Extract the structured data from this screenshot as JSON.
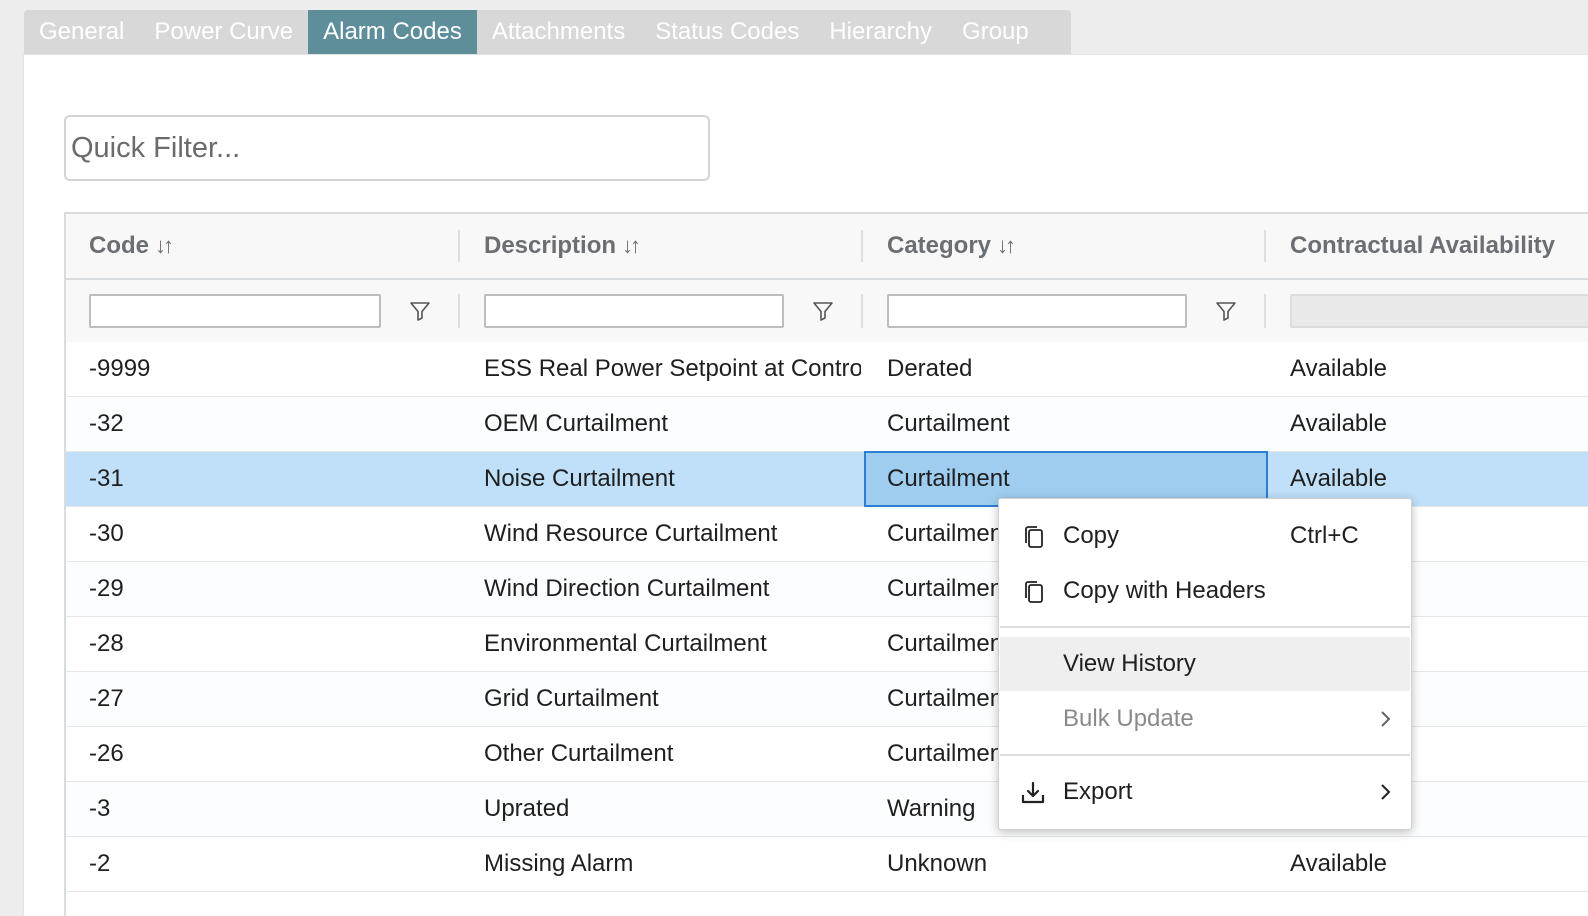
{
  "tabs": [
    {
      "label": "General",
      "active": false
    },
    {
      "label": "Power Curve",
      "active": false
    },
    {
      "label": "Alarm Codes",
      "active": true
    },
    {
      "label": "Attachments",
      "active": false
    },
    {
      "label": "Status Codes",
      "active": false
    },
    {
      "label": "Hierarchy",
      "active": false
    },
    {
      "label": "Group",
      "active": false
    }
  ],
  "quick_filter": {
    "placeholder": "Quick Filter...",
    "value": ""
  },
  "grid": {
    "columns": [
      {
        "label": "Code",
        "sort_icon": "↓↑",
        "filter_value": ""
      },
      {
        "label": "Description",
        "sort_icon": "↓↑",
        "filter_value": ""
      },
      {
        "label": "Category",
        "sort_icon": "↓↑",
        "filter_value": ""
      },
      {
        "label": "Contractual Availability",
        "sort_icon": "",
        "filter_value": ""
      }
    ],
    "rows": [
      {
        "code": "-9999",
        "description": "ESS Real Power Setpoint at Control",
        "category": "Derated",
        "availability": "Available"
      },
      {
        "code": "-32",
        "description": "OEM Curtailment",
        "category": "Curtailment",
        "availability": "Available"
      },
      {
        "code": "-31",
        "description": "Noise Curtailment",
        "category": "Curtailment",
        "availability": "Available",
        "selected": true
      },
      {
        "code": "-30",
        "description": "Wind Resource Curtailment",
        "category": "Curtailment",
        "availability": ""
      },
      {
        "code": "-29",
        "description": "Wind Direction Curtailment",
        "category": "Curtailment",
        "availability": ""
      },
      {
        "code": "-28",
        "description": "Environmental Curtailment",
        "category": "Curtailment",
        "availability": ""
      },
      {
        "code": "-27",
        "description": "Grid Curtailment",
        "category": "Curtailment",
        "availability": ""
      },
      {
        "code": "-26",
        "description": "Other Curtailment",
        "category": "Curtailment",
        "availability": ""
      },
      {
        "code": "-3",
        "description": "Uprated",
        "category": "Warning",
        "availability": ""
      },
      {
        "code": "-2",
        "description": "Missing Alarm",
        "category": "Unknown",
        "availability": "Available"
      }
    ]
  },
  "context_menu": {
    "copy": {
      "label": "Copy",
      "shortcut": "Ctrl+C",
      "icon": "copy-icon"
    },
    "copy_headers": {
      "label": "Copy with Headers",
      "icon": "copy-icon"
    },
    "view_history": {
      "label": "View History"
    },
    "bulk_update": {
      "label": "Bulk Update",
      "icon": "chevron-right-icon"
    },
    "export": {
      "label": "Export",
      "icon": "download-icon"
    }
  },
  "colors": {
    "active_tab": "#5e8e9a",
    "selected_row": "#bfe0f8",
    "focus_border": "#2c7fd0"
  }
}
